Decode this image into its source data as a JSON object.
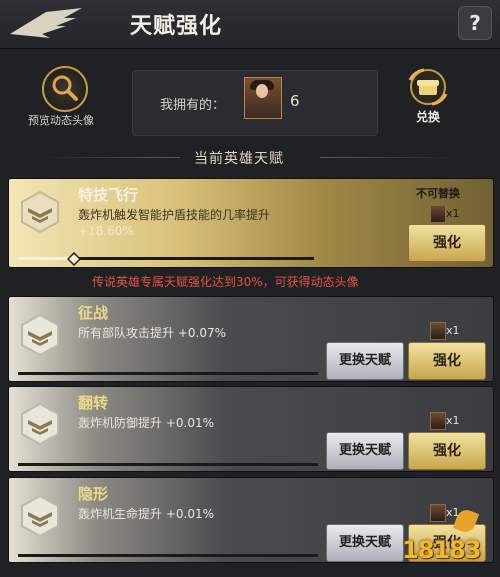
{
  "header": {
    "title": "天赋强化",
    "help_label": "?"
  },
  "topbar": {
    "preview_label": "预览动态头像",
    "owned_label": "我拥有的：",
    "owned_count": "6",
    "exchange_label": "兑换"
  },
  "section_title": "当前英雄天赋",
  "talents": [
    {
      "name": "特技飞行",
      "desc": "轰炸机触发智能护盾技能的几率提升",
      "value": "+18.60%",
      "tag": "不可替换",
      "cost": "x1",
      "enhance_label": "强化",
      "progress": 0.19
    },
    {
      "name": "征战",
      "desc": "所有部队攻击提升 +0.07%",
      "cost": "x1",
      "swap_label": "更换天赋",
      "enhance_label": "强化"
    },
    {
      "name": "翻转",
      "desc": "轰炸机防御提升 +0.01%",
      "cost": "x1",
      "swap_label": "更换天赋",
      "enhance_label": "强化"
    },
    {
      "name": "隐形",
      "desc": "轰炸机生命提升 +0.01%",
      "cost": "x1",
      "swap_label": "更换天赋",
      "enhance_label": "强化"
    }
  ],
  "notice": "传说英雄专属天赋强化达到30%，可获得动态头像",
  "watermark": "18183",
  "colors": {
    "gold": "#d8c179",
    "red_notice": "#e8523d",
    "badge_gold": "#c49a45"
  }
}
